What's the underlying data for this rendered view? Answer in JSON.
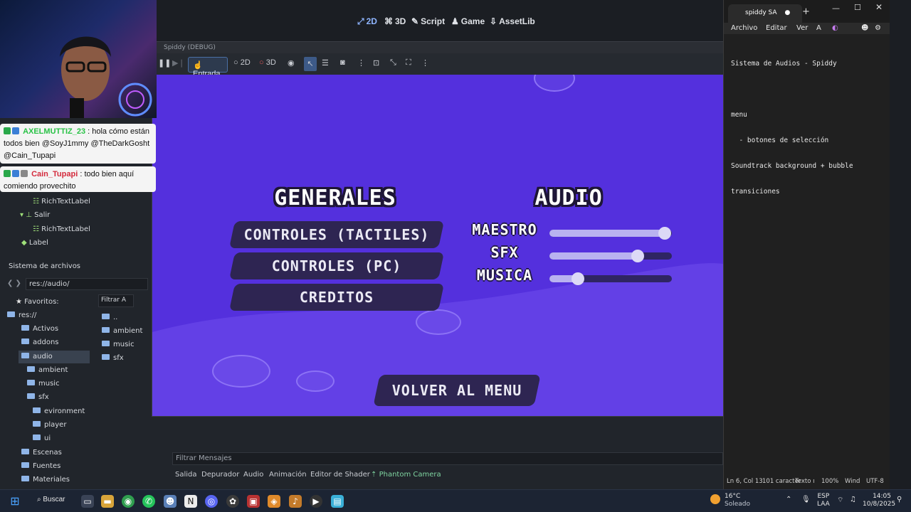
{
  "editor": {
    "modes": [
      "2D",
      "3D",
      "Script",
      "Game",
      "AssetLib"
    ]
  },
  "game_window": {
    "title": "Spiddy (DEBUG)",
    "toolbar": {
      "entrada": "Entrada",
      "mode_2d": "2D",
      "mode_3d": "3D"
    },
    "ui": {
      "generales_title": "GENERALES",
      "audio_title": "AUDIO",
      "buttons": [
        "CONTROLES (TACTILES)",
        "CONTROLES (PC)",
        "CREDITOS"
      ],
      "volume_labels": [
        "MAESTRO",
        "SFX",
        "MUSICA"
      ],
      "volume_levels": [
        0.94,
        0.72,
        0.23
      ],
      "back_button": "VOLVER AL MENU"
    }
  },
  "chat": [
    {
      "user": "AXELMUTTIZ_23",
      "user_color": "#29c246",
      "text": ": hola cómo están todos bien @SoyJ1mmy @TheDarkGosht @Cain_Tupapi"
    },
    {
      "user": "Cain_Tupapi",
      "user_color": "#d42a3c",
      "text": ": todo bien aquí comiendo provechito"
    }
  ],
  "scene_tree": {
    "items": [
      "RichTextLabel",
      "Salir",
      "RichTextLabel",
      "Label"
    ]
  },
  "filesystem": {
    "title": "Sistema de archivos",
    "path": "res://audio/",
    "filter_placeholder": "Filtrar A",
    "tree": [
      "Favoritos:",
      "res://",
      "Activos",
      "addons",
      "audio",
      "ambient",
      "music",
      "sfx",
      "evironment",
      "player",
      "ui",
      "Escenas",
      "Fuentes",
      "Materiales"
    ],
    "list": [
      "..",
      "ambient",
      "music",
      "sfx"
    ]
  },
  "bottom_dock": {
    "filter": "Filtrar Mensajes",
    "tabs": [
      "Salida",
      "Depurador",
      "Audio",
      "Animación",
      "Editor de Shader",
      "Phantom Camera"
    ]
  },
  "notepad": {
    "tab_title": "spiddy SA",
    "menu": [
      "Archivo",
      "Editar",
      "Ver"
    ],
    "lines": [
      "Sistema de Audios - Spiddy",
      "",
      "menu",
      "  - botones de selección",
      "Soundtrack background + bubble",
      "transiciones"
    ],
    "status": {
      "position": "Ln 6, Col 13",
      "chars": "101 caracter",
      "type": "Texto ı",
      "zoom": "100%",
      "eol": "Wind",
      "encoding": "UTF-8"
    }
  },
  "taskbar": {
    "search": "Buscar",
    "weather_temp": "16°C",
    "weather_desc": "Soleado",
    "lang": "ESP",
    "lang2": "LAA",
    "time": "14:05",
    "date": "10/8/2025"
  }
}
